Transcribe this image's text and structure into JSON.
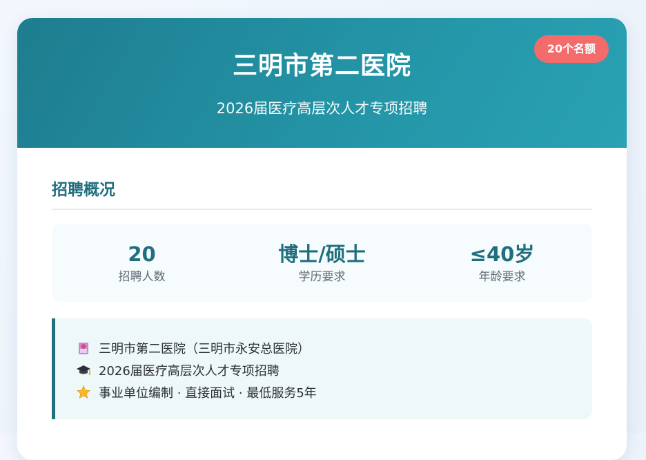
{
  "header": {
    "title": "三明市第二医院",
    "subtitle": "2026届医疗高层次人才专项招聘",
    "badge": "20个名额"
  },
  "overview": {
    "section_title": "招聘概况",
    "stats": [
      {
        "value": "20",
        "label": "招聘人数"
      },
      {
        "value": "博士/硕士",
        "label": "学历要求"
      },
      {
        "value": "≤40岁",
        "label": "年龄要求"
      }
    ]
  },
  "info": {
    "lines": [
      {
        "icon": "hospital-icon",
        "text": "三明市第二医院（三明市永安总医院）"
      },
      {
        "icon": "graduation-cap-icon",
        "text": "2026届医疗高层次人才专项招聘"
      },
      {
        "icon": "star-icon",
        "text": "事业单位编制 · 直接面试 · 最低服务5年"
      }
    ]
  },
  "colors": {
    "header_gradient_start": "#1e7d8f",
    "header_gradient_end": "#29a2b3",
    "badge_bg": "#f36b6b",
    "accent": "#1f6f7e",
    "stats_bg": "#f6fbfd",
    "info_bg": "#eff8f9"
  }
}
